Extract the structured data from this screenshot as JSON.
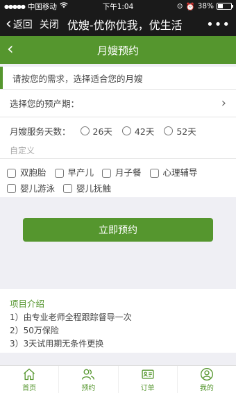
{
  "status_bar": {
    "carrier": "中国移动",
    "time": "下午1:04",
    "battery": "38%",
    "battery_level": 0.38
  },
  "wechat_bar": {
    "back_label": "返回",
    "close_label": "关闭",
    "title": "优嫂-优你优我，优生活",
    "more": "•••"
  },
  "app_bar": {
    "title": "月嫂预约"
  },
  "hint": "请按您的需求，选择适合您的月嫂",
  "due_date": {
    "label": "选择您的预产期："
  },
  "service_days": {
    "label": "月嫂服务天数：",
    "options": [
      "26天",
      "42天",
      "52天"
    ],
    "custom_placeholder": "自定义"
  },
  "extras": [
    "双胞胎",
    "早产儿",
    "月子餐",
    "心理辅导",
    "婴儿游泳",
    "婴儿抚触"
  ],
  "submit_label": "立即预约",
  "intro": {
    "heading": "项目介绍",
    "items": [
      "1）由专业老师全程跟踪督导一次",
      "2）50万保险",
      "3）3天试用期无条件更换"
    ]
  },
  "tabbar": [
    {
      "label": "首页",
      "icon": "home-icon"
    },
    {
      "label": "预约",
      "icon": "users-icon"
    },
    {
      "label": "订单",
      "icon": "order-card-icon"
    },
    {
      "label": "我的",
      "icon": "user-icon"
    }
  ],
  "colors": {
    "accent": "#55962e",
    "dark_bar": "#1a1a1a",
    "background": "#efeff4"
  }
}
